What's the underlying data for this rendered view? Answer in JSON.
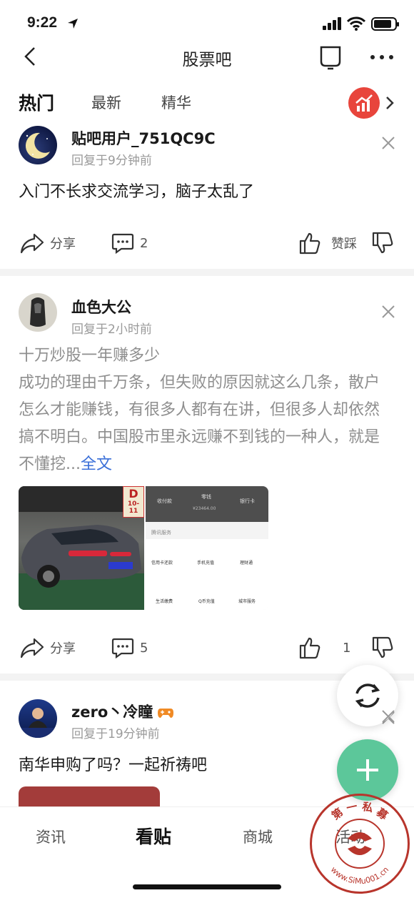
{
  "status": {
    "time": "9:22"
  },
  "nav": {
    "title": "股票吧"
  },
  "tabs": [
    {
      "label": "热门",
      "active": true
    },
    {
      "label": "最新",
      "active": false
    },
    {
      "label": "精华",
      "active": false
    }
  ],
  "posts": [
    {
      "username": "贴吧用户_751QC9C",
      "meta": "回复于9分钟前",
      "content": "入门不长求交流学习，脑子太乱了",
      "share_label": "分享",
      "comment_count": "2",
      "like_label": "赞踩"
    },
    {
      "username": "血色大公",
      "meta": "回复于2小时前",
      "content": "十万炒股一年赚多少\n成功的理由千万条，但失败的原因就这么几条，散户怎么才能赚钱，有很多人都有在讲，但很多人却依然搞不明白。中国股市里永远赚不到钱的一种人，就是不懂挖...",
      "fulltext_label": "全文",
      "share_label": "分享",
      "comment_count": "5",
      "like_count": "1",
      "image1": {
        "parking_sign": "D",
        "parking_no": "10-11"
      },
      "image2": {
        "top_items": [
          "收付款",
          "零钱",
          "银行卡"
        ],
        "balance": "¥23464.00",
        "section": "腾讯服务",
        "grid": [
          "信用卡还款",
          "手机充值",
          "理财通",
          "生活缴费",
          "Q币充值",
          "城市服务"
        ]
      }
    },
    {
      "username": "zero丶冷瞳",
      "meta": "回复于19分钟前",
      "content": "南华申购了吗？一起祈祷吧"
    }
  ],
  "bottom_nav": [
    {
      "label": "资讯",
      "active": false
    },
    {
      "label": "看贴",
      "active": true
    },
    {
      "label": "商城",
      "active": false
    },
    {
      "label": "活动",
      "active": false
    }
  ],
  "stamp": {
    "top": "第 一 私 募",
    "bottom": "www.SiMu001.cn"
  },
  "colors": {
    "link": "#3a6fd8",
    "fab": "#5cc79a",
    "trend": "#e8453c",
    "stamp": "#b8352c"
  }
}
